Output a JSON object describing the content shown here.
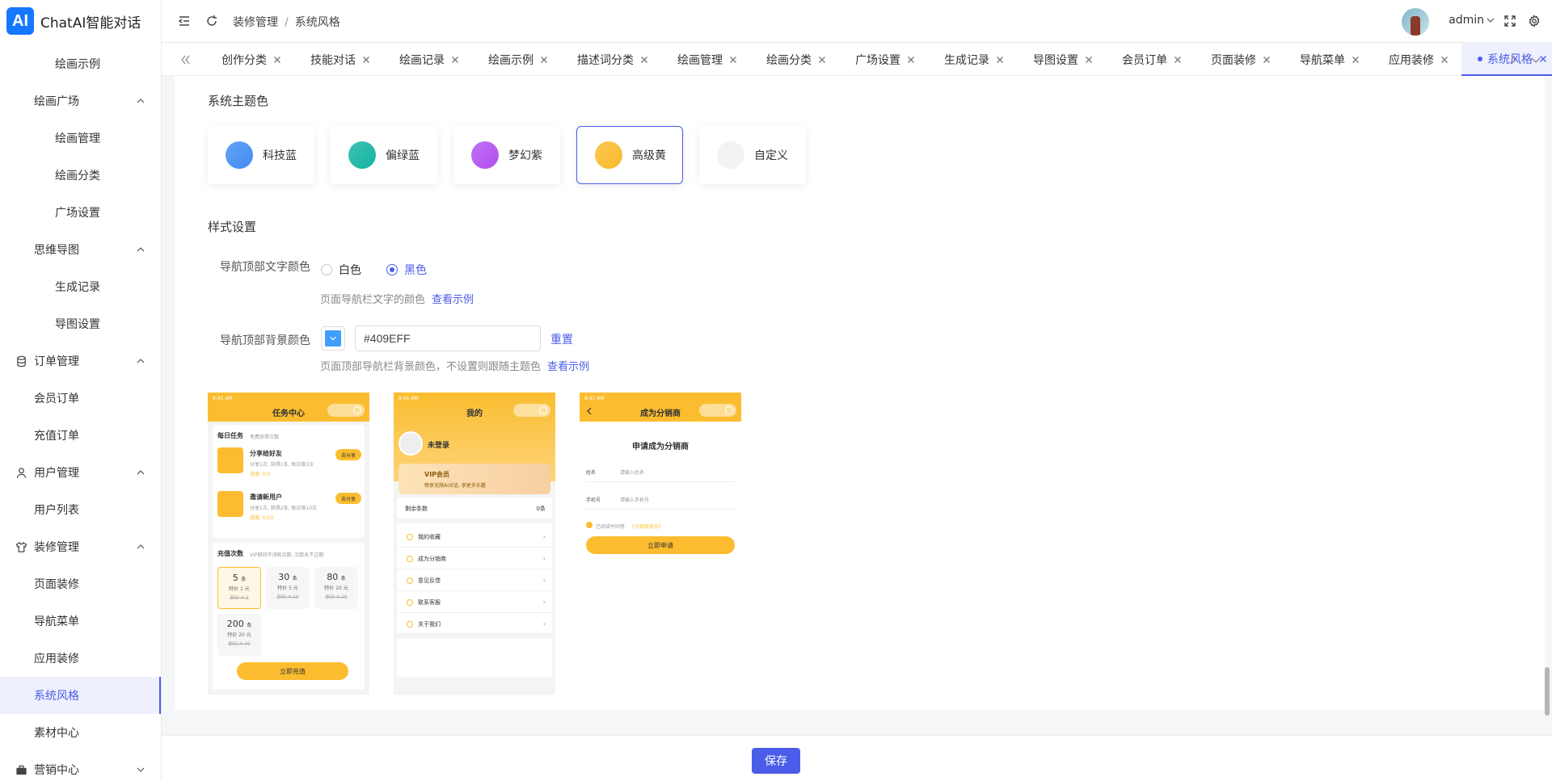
{
  "app": {
    "logo_mark": "AI",
    "name": "ChatAI智能对话"
  },
  "sidebar": {
    "items": [
      {
        "label": "绘画示例",
        "level": 3
      },
      {
        "label": "绘画广场",
        "level": 2,
        "expanded": true
      },
      {
        "label": "绘画管理",
        "level": 3
      },
      {
        "label": "绘画分类",
        "level": 3
      },
      {
        "label": "广场设置",
        "level": 3
      },
      {
        "label": "思维导图",
        "level": 2,
        "expanded": true
      },
      {
        "label": "生成记录",
        "level": 3
      },
      {
        "label": "导图设置",
        "level": 3
      },
      {
        "label": "订单管理",
        "level": 1,
        "icon": "database-icon",
        "expanded": true
      },
      {
        "label": "会员订单",
        "level": 2
      },
      {
        "label": "充值订单",
        "level": 2
      },
      {
        "label": "用户管理",
        "level": 1,
        "icon": "user-icon",
        "expanded": true
      },
      {
        "label": "用户列表",
        "level": 2
      },
      {
        "label": "装修管理",
        "level": 1,
        "icon": "shirt-icon",
        "expanded": true
      },
      {
        "label": "页面装修",
        "level": 2
      },
      {
        "label": "导航菜单",
        "level": 2
      },
      {
        "label": "应用装修",
        "level": 2
      },
      {
        "label": "系统风格",
        "level": 2,
        "active": true
      },
      {
        "label": "素材中心",
        "level": 2
      },
      {
        "label": "营销中心",
        "level": 1,
        "icon": "briefcase-icon",
        "expanded": false
      }
    ]
  },
  "header": {
    "breadcrumb": [
      "装修管理",
      "系统风格"
    ],
    "breadcrumb_sep": "/",
    "username": "admin"
  },
  "tabs": [
    {
      "label": "创作分类"
    },
    {
      "label": "技能对话"
    },
    {
      "label": "绘画记录"
    },
    {
      "label": "绘画示例"
    },
    {
      "label": "描述词分类"
    },
    {
      "label": "绘画管理"
    },
    {
      "label": "绘画分类"
    },
    {
      "label": "广场设置"
    },
    {
      "label": "生成记录"
    },
    {
      "label": "导图设置"
    },
    {
      "label": "会员订单"
    },
    {
      "label": "页面装修"
    },
    {
      "label": "导航菜单"
    },
    {
      "label": "应用装修"
    },
    {
      "label": "系统风格",
      "active": true
    }
  ],
  "theme": {
    "section_title": "系统主题色",
    "options": [
      {
        "label": "科技蓝",
        "color": "#3f8cf3"
      },
      {
        "label": "偏绿蓝",
        "color": "#12b3a0"
      },
      {
        "label": "梦幻紫",
        "color": "#b04ef0"
      },
      {
        "label": "高级黄",
        "color": "#fbb92a",
        "selected": true
      },
      {
        "label": "自定义",
        "color": "#f3f3f3"
      }
    ]
  },
  "style": {
    "section_title": "样式设置",
    "nav_text_color": {
      "label": "导航顶部文字颜色",
      "options": [
        "白色",
        "黑色"
      ],
      "selected": "黑色",
      "hint": "页面导航栏文字的颜色",
      "hint_link": "查看示例"
    },
    "nav_bg_color": {
      "label": "导航顶部背景颜色",
      "value": "#409EFF",
      "reset": "重置",
      "hint": "页面顶部导航栏背景颜色，不设置则跟随主题色",
      "hint_link": "查看示例"
    }
  },
  "previews": {
    "task": {
      "title": "任务中心",
      "daily": "每日任务",
      "daily_sub": "免费获得次数",
      "share_title": "分享给好友",
      "share_desc": "分享1次, 获得1条, 每日限3次",
      "share_progress": "进度: 0/3",
      "share_btn": "去分享",
      "invite_title": "邀请新用户",
      "invite_desc": "分享1次, 获得2条, 每日限10次",
      "invite_progress": "进度: 0/10",
      "invite_btn": "去分享",
      "recharge": "充值次数",
      "recharge_sub": "VIP期间不消耗次数, 次数永不过期",
      "packs": [
        {
          "n": "5",
          "u": "条",
          "p": "特价 1 元",
          "o": "原价 ¥ 2",
          "sel": true
        },
        {
          "n": "30",
          "u": "条",
          "p": "特价 5 元",
          "o": "原价 ¥ 10"
        },
        {
          "n": "80",
          "u": "条",
          "p": "特价 10 元",
          "o": "原价 ¥ 20"
        },
        {
          "n": "200",
          "u": "条",
          "p": "特价 20 元",
          "o": "原价 ¥ 40"
        }
      ],
      "buy_btn": "立即充值"
    },
    "mine": {
      "title": "我的",
      "login": "未登录",
      "vip_title": "VIP会员",
      "vip_desc": "畅享无限AI对话, 享更多乐趣",
      "balance_label": "剩余条数",
      "balance_value": "0条",
      "rows": [
        "我的收藏",
        "成为分销商",
        "意见反馈",
        "联系客服",
        "关于我们"
      ]
    },
    "dist": {
      "title": "成为分销商",
      "heading": "申请成为分销商",
      "name_label": "姓名",
      "name_ph": "请输入姓名",
      "phone_label": "手机号",
      "phone_ph": "请输入手机号",
      "agree": "已阅读并同意",
      "agree_link": "《分销商协议》",
      "submit": "立即申请"
    }
  },
  "footer": {
    "save": "保存"
  }
}
